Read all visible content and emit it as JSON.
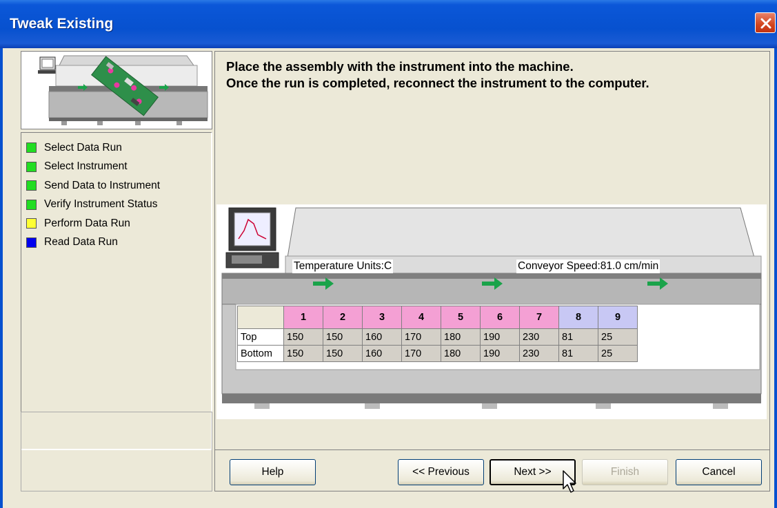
{
  "window": {
    "title": "Tweak Existing"
  },
  "steps": [
    {
      "label": "Select Data Run",
      "color": "#22dd22"
    },
    {
      "label": "Select Instrument",
      "color": "#22dd22"
    },
    {
      "label": "Send Data to Instrument",
      "color": "#22dd22"
    },
    {
      "label": "Verify Instrument Status",
      "color": "#22dd22"
    },
    {
      "label": "Perform Data Run",
      "color": "#ffff33"
    },
    {
      "label": "Read Data Run",
      "color": "#0000ee"
    }
  ],
  "instructions": {
    "line1": "Place the assembly with the instrument into the machine.",
    "line2": "Once the run is completed, reconnect the instrument to the computer."
  },
  "machine": {
    "temperature_units": "Temperature Units:C",
    "conveyor_speed": "Conveyor Speed:81.0  cm/min"
  },
  "zone_table": {
    "zones": [
      "1",
      "2",
      "3",
      "4",
      "5",
      "6",
      "7",
      "8",
      "9"
    ],
    "zone_colors": [
      "#f4a0d4",
      "#f4a0d4",
      "#f4a0d4",
      "#f4a0d4",
      "#f4a0d4",
      "#f4a0d4",
      "#f4a0d4",
      "#c8c8f4",
      "#c8c8f4"
    ],
    "rows": [
      {
        "label": "Top",
        "values": [
          "150",
          "150",
          "160",
          "170",
          "180",
          "190",
          "230",
          "81",
          "25"
        ]
      },
      {
        "label": "Bottom",
        "values": [
          "150",
          "150",
          "160",
          "170",
          "180",
          "190",
          "230",
          "81",
          "25"
        ]
      }
    ]
  },
  "buttons": {
    "help": "Help",
    "previous": "<< Previous",
    "next": "Next >>",
    "finish": "Finish",
    "cancel": "Cancel"
  }
}
